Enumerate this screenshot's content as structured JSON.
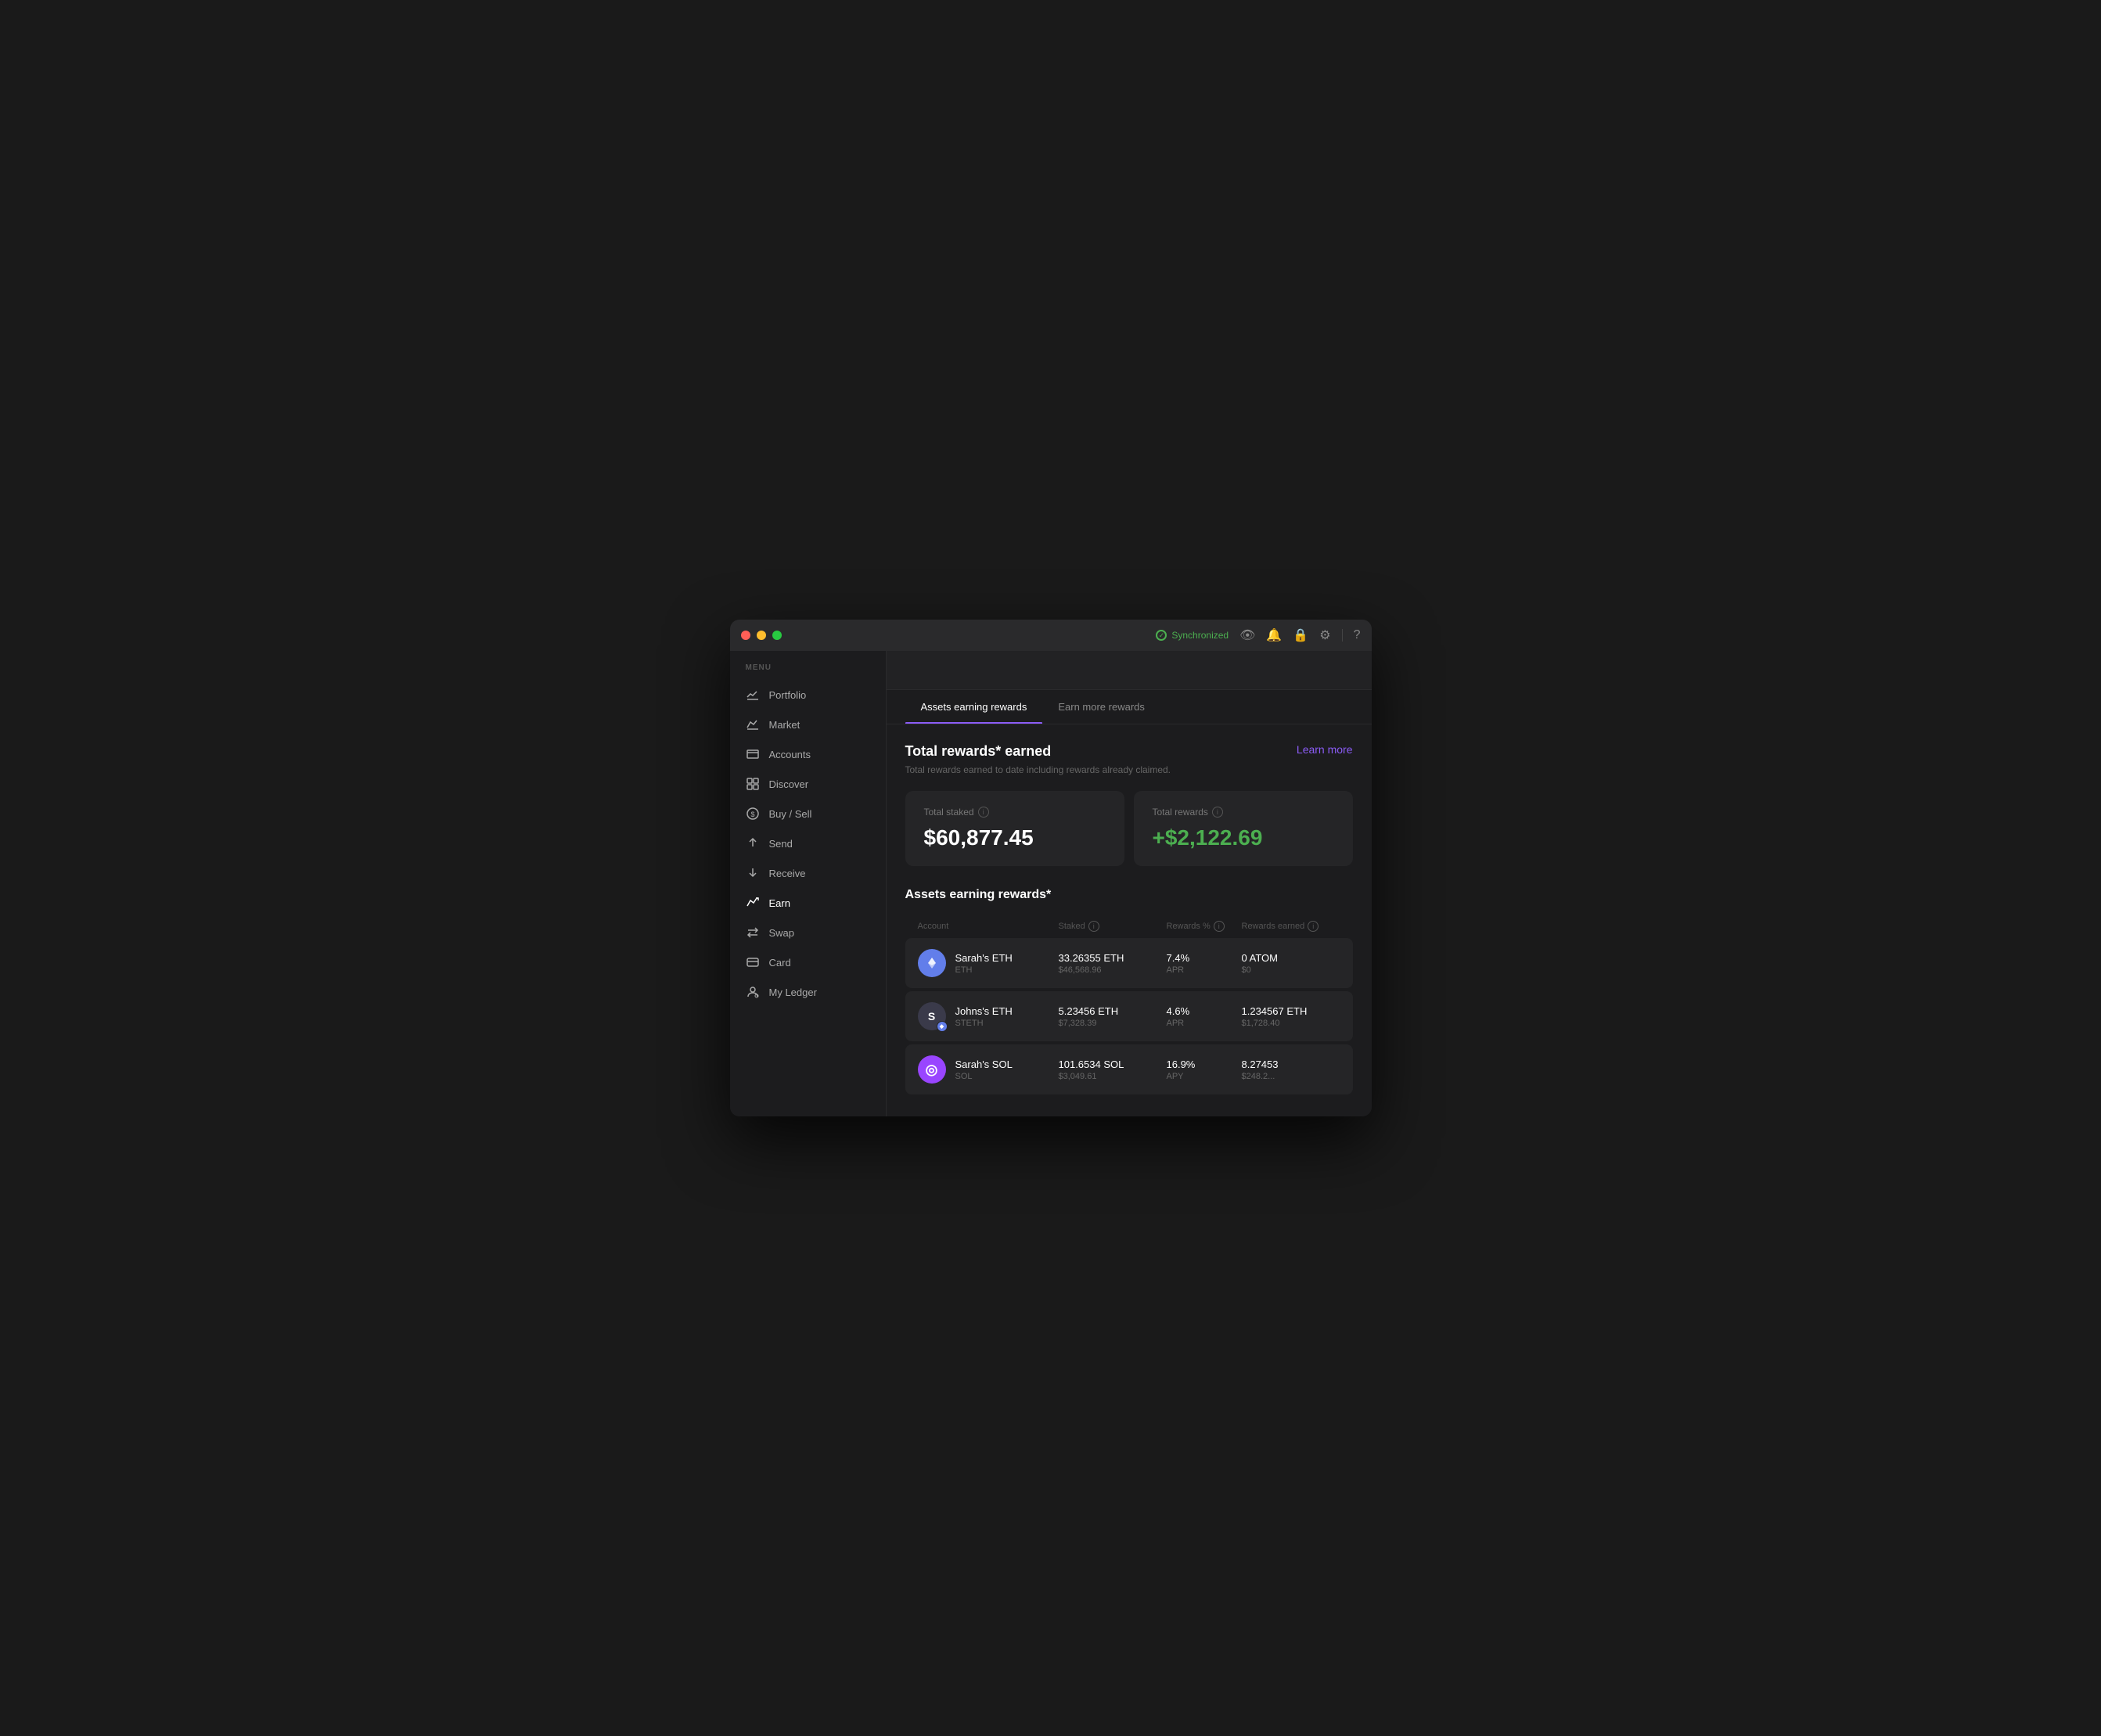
{
  "window": {
    "sync_label": "Synchronized"
  },
  "sidebar": {
    "menu_label": "MENU",
    "items": [
      {
        "id": "portfolio",
        "label": "Portfolio"
      },
      {
        "id": "market",
        "label": "Market"
      },
      {
        "id": "accounts",
        "label": "Accounts"
      },
      {
        "id": "discover",
        "label": "Discover"
      },
      {
        "id": "buysell",
        "label": "Buy / Sell"
      },
      {
        "id": "send",
        "label": "Send"
      },
      {
        "id": "receive",
        "label": "Receive"
      },
      {
        "id": "earn",
        "label": "Earn"
      },
      {
        "id": "swap",
        "label": "Swap"
      },
      {
        "id": "card",
        "label": "Card"
      },
      {
        "id": "myledger",
        "label": "My Ledger"
      }
    ]
  },
  "tabs": [
    {
      "id": "assets-earning",
      "label": "Assets earning rewards",
      "active": true
    },
    {
      "id": "earn-more",
      "label": "Earn more rewards",
      "active": false
    }
  ],
  "rewards": {
    "title": "Total rewards* earned",
    "subtitle": "Total rewards earned to date including rewards already claimed.",
    "learn_more": "Learn more",
    "total_staked_label": "Total staked",
    "total_staked_value": "$60,877.45",
    "total_rewards_label": "Total rewards",
    "total_rewards_value": "+$2,122.69"
  },
  "assets_section": {
    "title": "Assets earning rewards*",
    "table_headers": {
      "account": "Account",
      "staked": "Staked",
      "rewards_pct": "Rewards %",
      "rewards_earned": "Rewards earned"
    },
    "rows": [
      {
        "name": "Sarah's ETH",
        "ticker": "ETH",
        "avatar_type": "eth",
        "avatar_symbol": "◆",
        "staked_amount": "33.26355 ETH",
        "staked_usd": "$46,568.96",
        "rate": "7.4%",
        "rate_type": "APR",
        "earned_amount": "0 ATOM",
        "earned_usd": "$0"
      },
      {
        "name": "Johns's ETH",
        "ticker": "STETH",
        "avatar_type": "steth",
        "avatar_symbol": "S",
        "staked_amount": "5.23456 ETH",
        "staked_usd": "$7,328.39",
        "rate": "4.6%",
        "rate_type": "APR",
        "earned_amount": "1.234567 ETH",
        "earned_usd": "$1,728.40"
      },
      {
        "name": "Sarah's SOL",
        "ticker": "SOL",
        "avatar_type": "sol",
        "avatar_symbol": "◎",
        "staked_amount": "101.6534 SOL",
        "staked_usd": "$3,049.61",
        "rate": "16.9%",
        "rate_type": "APY",
        "earned_amount": "8.27453",
        "earned_usd": "$248.2..."
      }
    ]
  }
}
